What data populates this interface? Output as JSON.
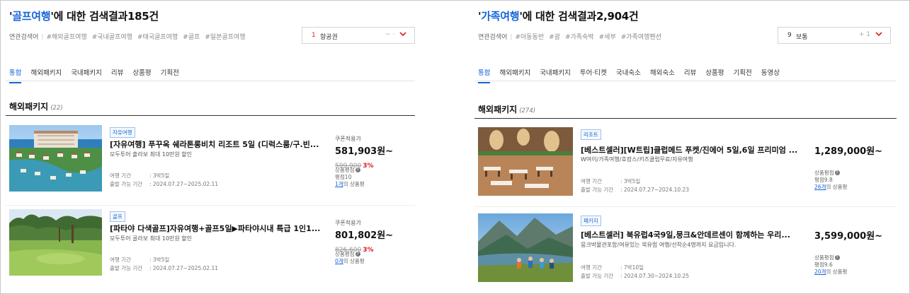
{
  "panels": [
    {
      "title": {
        "quote_open": "'",
        "keyword": "골프여행",
        "rest": "'에 대한 검색결과185건"
      },
      "related": {
        "label": "연관검색어",
        "tags": [
          "#해외골프여행",
          "#국내골프여행",
          "#태국골프여행",
          "#골프",
          "#일본골프여행"
        ]
      },
      "sort": {
        "num": "1",
        "label": "항공권",
        "arrows": "− ·"
      },
      "tabs": [
        "통합",
        "해외패키지",
        "국내패키지",
        "리뷰",
        "상품평",
        "기획전"
      ],
      "section": {
        "title": "해외패키지",
        "count": "(22)"
      },
      "items": [
        {
          "badge": "자유여행",
          "title": "[자유여행] 푸꾸옥 쉐라톤롱비치 리조트 5일 (디럭스룸/구.빈...",
          "subtitle": "모두투어 출라보 최대 10만원 할인",
          "meta_label1": "여행 기간",
          "meta_value1": ": 3박5일",
          "meta_label2": "출발 가능 기간",
          "meta_value2": ": 2024.07.27~2025.02.11",
          "price_label": "쿠폰적용가",
          "price": "581,903원~",
          "orig_price": "599,900",
          "discount": "3%",
          "rating_label": "상품평점",
          "rating": "평점10",
          "review_link": "1개",
          "review_text": "의 상품평"
        },
        {
          "badge": "골프",
          "title": "[파타야 다색골프]자유여행+골프5일▶파타야시내 특급 1인1...",
          "subtitle": "모두투어 골라보 최대 10만원 할인",
          "meta_label1": "여행 기간",
          "meta_value1": ": 3박5일",
          "meta_label2": "출발 가능 기간",
          "meta_value2": ": 2024.07.27~2025.02.11",
          "price_label": "쿠폰적용가",
          "price": "801,802원~",
          "orig_price": "826,600",
          "discount": "3%",
          "rating_label": "상품평점",
          "rating": "",
          "review_link": "0개",
          "review_text": "의 상품평"
        }
      ]
    },
    {
      "title": {
        "quote_open": "'",
        "keyword": "가족여행",
        "rest": "'에 대한 검색결과2,904건"
      },
      "related": {
        "label": "연관검색어",
        "tags": [
          "#아동동반",
          "#괌",
          "#가족숙박",
          "#세부",
          "#가족여행펜션"
        ]
      },
      "sort": {
        "num": "9",
        "label": "보통",
        "arrows": "+ 1"
      },
      "tabs": [
        "통합",
        "해외패키지",
        "국내패키지",
        "투어·티켓",
        "국내숙소",
        "해외숙소",
        "리뷰",
        "상품평",
        "기획전",
        "동영상"
      ],
      "section": {
        "title": "해외패키지",
        "count": "(274)"
      },
      "items": [
        {
          "badge": "리조트",
          "title": "[베스트셀러][W트립]클럽메드 푸켓/진에어 5일,6일 프리미엄 ...",
          "subtitle": "W여이/가족여행/호캉스/키즈클럽무료/자유여행",
          "meta_label1": "여행 기간",
          "meta_value1": ": 3박5일",
          "meta_label2": "출발 가능 기간",
          "meta_value2": ": 2024.07.27~2024.10.23",
          "price_label": "",
          "price": "1,289,000원~",
          "orig_price": "",
          "discount": "",
          "rating_label": "상품평점",
          "rating": "평점9.8",
          "review_link": "26개",
          "review_text": "의 상품평"
        },
        {
          "badge": "패키지",
          "title": "[베스트셀러] 북유럽4국9일,뭉크&안데르센이 함께하는 우리...",
          "subtitle": "뭉크박물관포함/여유있는 북유럽 여행/선착순4명까지 요금입니다.",
          "meta_label1": "여행 기간",
          "meta_value1": ": 7박10일",
          "meta_label2": "출발 가능 기간",
          "meta_value2": ": 2024.07.30~2024.10.25",
          "price_label": "",
          "price": "3,599,000원~",
          "orig_price": "",
          "discount": "",
          "rating_label": "상품평점",
          "rating": "평점9.6",
          "review_link": "20개",
          "review_text": "의 상품평"
        }
      ]
    }
  ]
}
